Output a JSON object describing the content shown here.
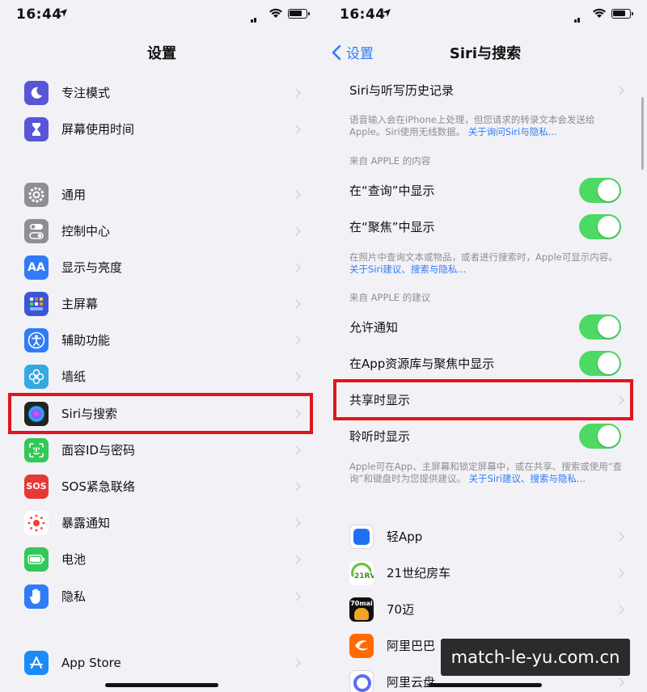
{
  "left": {
    "status_time": "16:44",
    "title": "设置",
    "items": [
      {
        "label": "专注模式",
        "icon": "moon-icon",
        "color": "#5856d6"
      },
      {
        "label": "屏幕使用时间",
        "icon": "hourglass-icon",
        "color": "#5856d6"
      },
      {
        "label": "通用",
        "icon": "gear-icon",
        "color": "#8e8e93"
      },
      {
        "label": "控制中心",
        "icon": "toggles-icon",
        "color": "#8e8e93"
      },
      {
        "label": "显示与亮度",
        "icon": "text-size-icon",
        "color": "#2f7cf6",
        "glyph": "AA"
      },
      {
        "label": "主屏幕",
        "icon": "home-grid-icon",
        "color": "#3a56d8"
      },
      {
        "label": "辅助功能",
        "icon": "accessibility-icon",
        "color": "#2f7cf6"
      },
      {
        "label": "墙纸",
        "icon": "flower-icon",
        "color": "#35a8e0"
      },
      {
        "label": "Siri与搜索",
        "icon": "siri-icon",
        "color": "#222"
      },
      {
        "label": "面容ID与密码",
        "icon": "faceid-icon",
        "color": "#34c759"
      },
      {
        "label": "SOS紧急联络",
        "icon": "sos-icon",
        "color": "#e53935",
        "glyph": "SOS"
      },
      {
        "label": "暴露通知",
        "icon": "exposure-icon",
        "color": "#ffffff"
      },
      {
        "label": "电池",
        "icon": "battery-icon",
        "color": "#34c759"
      },
      {
        "label": "隐私",
        "icon": "hand-icon",
        "color": "#2f7cf6"
      },
      {
        "label": "App Store",
        "icon": "appstore-icon",
        "color": "#1b8cf7"
      }
    ]
  },
  "right": {
    "status_time": "16:44",
    "back_label": "设置",
    "title": "Siri与搜索",
    "history_label": "Siri与听写历史记录",
    "note1": "语音输入会在iPhone上处理，但您请求的转录文本会发送给Apple。Siri使用无线数据。",
    "note1_link": "关于询问Siri与隐私...",
    "section1": "来自 APPLE 的内容",
    "rows1": [
      {
        "label": "在“查询”中显示",
        "on": true
      },
      {
        "label": "在“聚焦”中显示",
        "on": true
      }
    ],
    "note2": "在照片中查询文本或物品，或者进行搜索时，Apple可显示内容。",
    "note2_link": "关于Siri建议、搜索与隐私...",
    "section2": "来自 APPLE 的建议",
    "rows2": [
      {
        "label": "允许通知",
        "on": true
      },
      {
        "label": "在App资源库与聚焦中显示",
        "on": true
      }
    ],
    "shared_label": "共享时显示",
    "listen_label": "聆听时显示",
    "note3": "Apple可在App、主屏幕和锁定屏幕中，或在共享、搜索或使用“查询”和键盘时为您提供建议。",
    "note3_link": "关于Siri建议、搜索与隐私...",
    "apps": [
      {
        "label": "轻App",
        "icon": "qing-app-icon",
        "color": "#1f6ff2"
      },
      {
        "label": "21世纪房车",
        "icon": "rv21-icon",
        "color": "#ffffff"
      },
      {
        "label": "70迈",
        "icon": "70mai-icon",
        "color": "#111111",
        "glyph": "70mai"
      },
      {
        "label": "阿里巴巴",
        "icon": "alibaba-icon",
        "color": "#ff6a00"
      },
      {
        "label": "阿里云盘",
        "icon": "aliyun-drive-icon",
        "color": "#5b6cf7"
      }
    ]
  },
  "watermark": "match-le-yu.com.cn",
  "accent_color": "#2f7cf6",
  "highlight_color": "#e0161b",
  "toggle_color": "#4cd964"
}
